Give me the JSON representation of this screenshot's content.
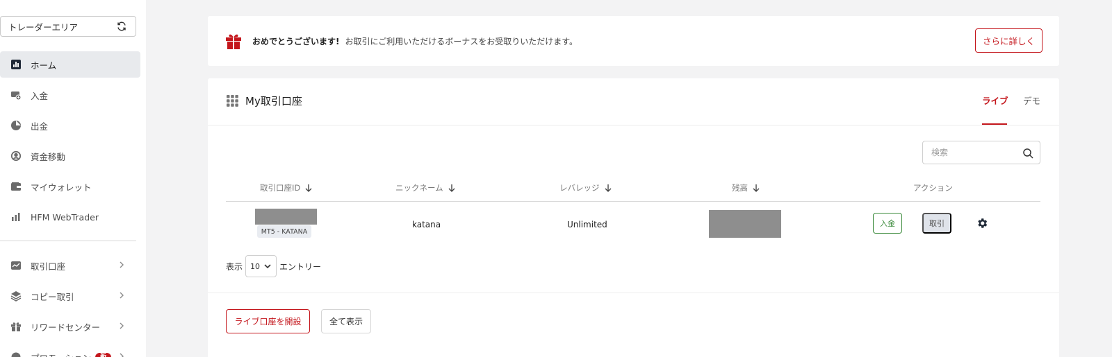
{
  "sidebar": {
    "area_label": "トレーダーエリア",
    "items": [
      {
        "label": "ホーム",
        "icon": "chart-icon"
      },
      {
        "label": "入金",
        "icon": "deposit-icon"
      },
      {
        "label": "出金",
        "icon": "withdraw-icon"
      },
      {
        "label": "資金移動",
        "icon": "transfer-icon"
      },
      {
        "label": "マイウォレット",
        "icon": "wallet-icon"
      },
      {
        "label": "HFM WebTrader",
        "icon": "bar-chart-icon"
      }
    ],
    "items2": [
      {
        "label": "取引口座",
        "icon": "trading-icon"
      },
      {
        "label": "コピー取引",
        "icon": "layers-icon"
      },
      {
        "label": "リワードセンター",
        "icon": "gift-icon"
      },
      {
        "label": "プロモーション",
        "icon": "promo-icon",
        "badge": "新"
      }
    ]
  },
  "banner": {
    "bold": "おめでとうございます!",
    "message": "お取引にご利用いただけるボーナスをお受取りいただけます。",
    "button": "さらに詳しく"
  },
  "accounts": {
    "title": "My取引口座",
    "tabs": {
      "live": "ライブ",
      "demo": "デモ"
    },
    "search_placeholder": "検索",
    "columns": [
      "取引口座ID",
      "ニックネーム",
      "レバレッジ",
      "残高",
      "アクション"
    ],
    "rows": [
      {
        "account_type": "MT5 - KATANA",
        "nickname": "katana",
        "leverage": "Unlimited",
        "deposit": "入金",
        "trade": "取引"
      }
    ],
    "show_label": "表示",
    "page_size": "10",
    "entries_label": "エントリー",
    "open_live": "ライブ口座を開設",
    "show_all": "全て表示"
  },
  "colors": {
    "accent": "#c4161c",
    "success": "#3a8a3a"
  }
}
